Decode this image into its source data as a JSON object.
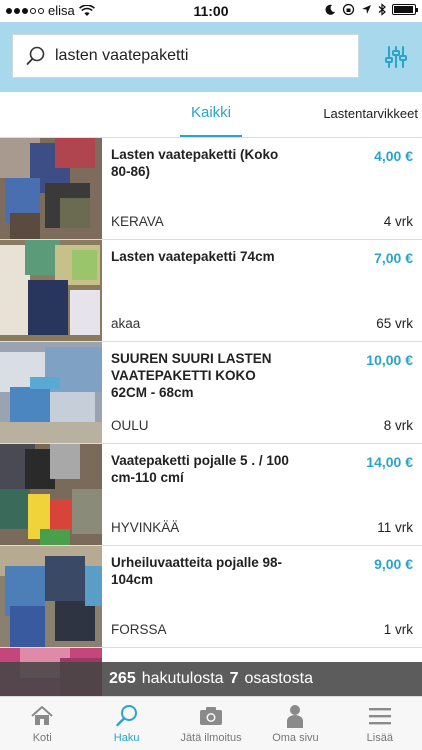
{
  "status_bar": {
    "carrier": "elisa",
    "time": "11:00"
  },
  "search": {
    "value": "lasten vaatepaketti",
    "placeholder": ""
  },
  "tabs": [
    {
      "label": "Kaikki",
      "active": true
    },
    {
      "label": "Lastentarvikkeet",
      "active": false
    }
  ],
  "listings": [
    {
      "title": "Lasten vaatepaketti (Koko 80-86)",
      "price": "4,00 €",
      "location": "KERAVA",
      "age": "4 vrk"
    },
    {
      "title": "Lasten vaatepaketti 74cm",
      "price": "7,00 €",
      "location": "akaa",
      "age": "65 vrk"
    },
    {
      "title": "SUUREN SUURI LASTEN VAATEPAKETTI KOKO 62CM - 68cm",
      "price": "10,00 €",
      "location": "OULU",
      "age": "8 vrk"
    },
    {
      "title": "Vaatepaketti pojalle 5 . / 100 cm-110 cmí",
      "price": "14,00 €",
      "location": "HYVINKÄÄ",
      "age": "11 vrk"
    },
    {
      "title": "Urheiluvaatteita pojalle 98-104cm",
      "price": "9,00 €",
      "location": "FORSSA",
      "age": "1 vrk"
    }
  ],
  "results_banner": {
    "count": "265",
    "middle": "hakutulosta",
    "categories": "7",
    "suffix": "osastosta"
  },
  "bottom_nav": [
    {
      "label": "Koti",
      "icon": "home-icon",
      "active": false
    },
    {
      "label": "Haku",
      "icon": "search-icon",
      "active": true
    },
    {
      "label": "Jätä ilmoitus",
      "icon": "camera-icon",
      "active": false
    },
    {
      "label": "Oma sivu",
      "icon": "person-icon",
      "active": false
    },
    {
      "label": "Lisää",
      "icon": "menu-icon",
      "active": false
    }
  ],
  "colors": {
    "accent": "#2aa5c9",
    "header_bg": "#a7d8ec",
    "banner_bg": "#464646"
  }
}
